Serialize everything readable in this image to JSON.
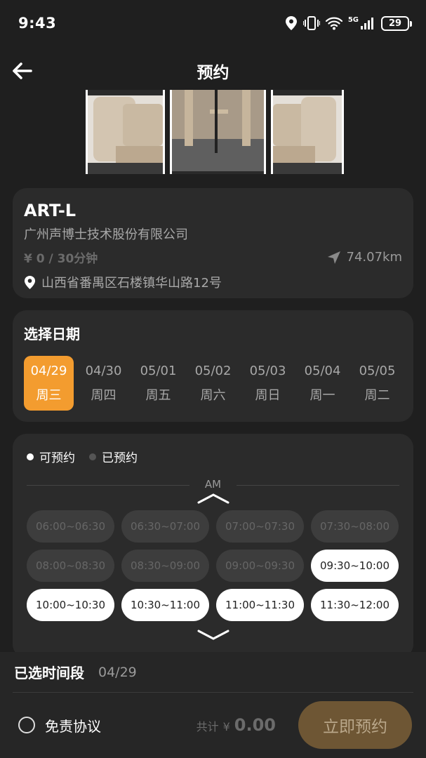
{
  "status_bar": {
    "time": "9:43",
    "network": "5G",
    "battery": "29"
  },
  "header": {
    "title": "预约"
  },
  "venue": {
    "name": "ART-L",
    "company": "广州声博士技术股份有限公司",
    "price": "¥ 0 / 30分钟",
    "distance": "74.07km",
    "address": "山西省番禺区石楼镇华山路12号"
  },
  "date_section": {
    "title": "选择日期",
    "dates": [
      {
        "date": "04/29",
        "weekday": "周三",
        "selected": true
      },
      {
        "date": "04/30",
        "weekday": "周四",
        "selected": false
      },
      {
        "date": "05/01",
        "weekday": "周五",
        "selected": false
      },
      {
        "date": "05/02",
        "weekday": "周六",
        "selected": false
      },
      {
        "date": "05/03",
        "weekday": "周日",
        "selected": false
      },
      {
        "date": "05/04",
        "weekday": "周一",
        "selected": false
      },
      {
        "date": "05/05",
        "weekday": "周二",
        "selected": false
      }
    ]
  },
  "slots_section": {
    "legend_available": "可预约",
    "legend_booked": "已预约",
    "period": "AM",
    "slots": [
      {
        "label": "06:00~06:30",
        "available": false
      },
      {
        "label": "06:30~07:00",
        "available": false
      },
      {
        "label": "07:00~07:30",
        "available": false
      },
      {
        "label": "07:30~08:00",
        "available": false
      },
      {
        "label": "08:00~08:30",
        "available": false
      },
      {
        "label": "08:30~09:00",
        "available": false
      },
      {
        "label": "09:00~09:30",
        "available": false
      },
      {
        "label": "09:30~10:00",
        "available": true
      },
      {
        "label": "10:00~10:30",
        "available": true
      },
      {
        "label": "10:30~11:00",
        "available": true
      },
      {
        "label": "11:00~11:30",
        "available": true
      },
      {
        "label": "11:30~12:00",
        "available": true
      }
    ]
  },
  "footer": {
    "selected_label": "已选时间段",
    "selected_date": "04/29",
    "agreement_label": "免责协议",
    "total_label": "共计",
    "currency": "¥",
    "total_amount": "0.00",
    "book_button": "立即预约"
  },
  "colors": {
    "background": "#1f1f1f",
    "card": "#2b2b2b",
    "accent": "#f39c2f",
    "book_button": "#6e5634"
  }
}
